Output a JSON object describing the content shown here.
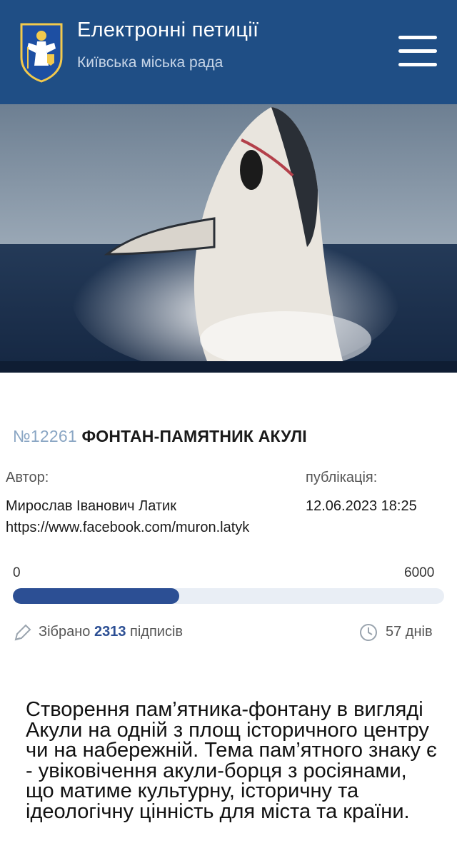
{
  "header": {
    "title": "Електронні петиції",
    "subtitle": "Київська міська рада",
    "logo_icon": "kyiv-coat-of-arms",
    "menu_icon": "hamburger-menu-icon",
    "bg_color": "#1f4e85"
  },
  "hero": {
    "image_description_icon": "shark-photo"
  },
  "petition": {
    "number": "№12261",
    "title": "ФОНТАН-ПАМЯТНИК АКУЛІ",
    "author_label": "Автор:",
    "author_name": "Мирослав Іванович Латик",
    "author_link": "https://www.facebook.com/muron.latyk",
    "published_label": "публікація:",
    "published_date": "12.06.2023 18:25",
    "progress": {
      "min": "0",
      "max": "6000",
      "collected": 2313,
      "fraction": 0.3855
    },
    "collected_prefix": "Зібрано",
    "collected_value": "2313",
    "collected_suffix": "підписів",
    "days_left": "57 днів",
    "description": "Створення пам’ятника-фонтану в вигляді Акули на одній з площ історичного центру чи на набережній. Тема пам’ятного знаку є - увіковічення акули-борця з росіянами, що матиме культурну, історичну та ідеологічну цінність для міста та країни."
  },
  "colors": {
    "accent": "#2c4f94",
    "number": "#8aa6c4",
    "track": "#e9eef5"
  }
}
